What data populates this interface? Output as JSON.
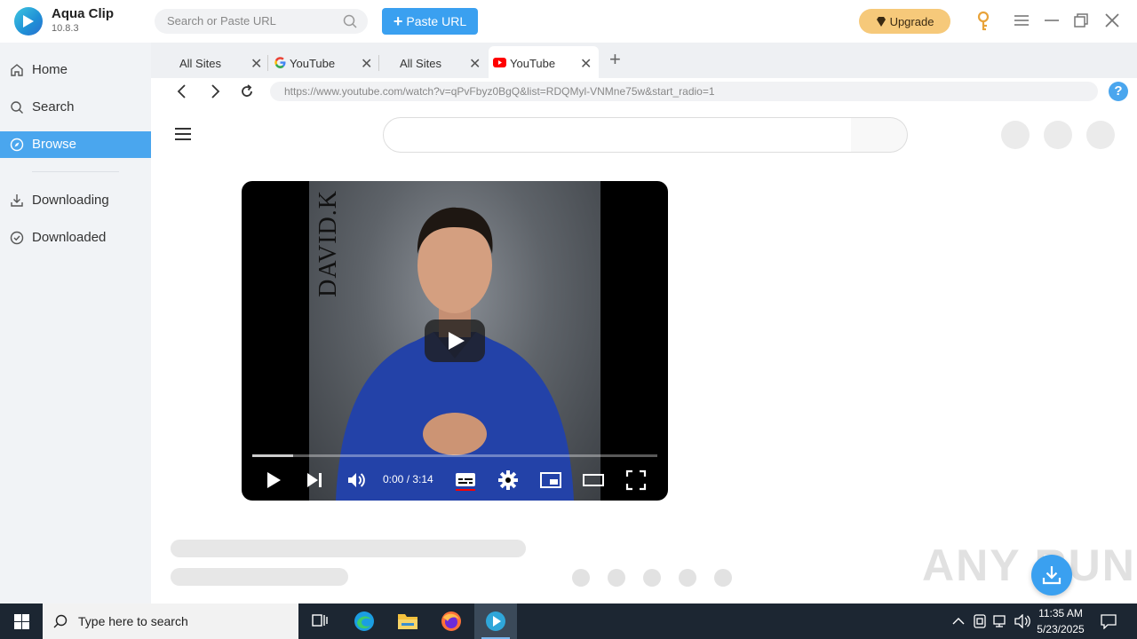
{
  "app": {
    "name": "Aqua Clip",
    "version": "10.8.3"
  },
  "header": {
    "search_placeholder": "Search or Paste URL",
    "paste_label": "Paste URL",
    "upgrade_label": "Upgrade"
  },
  "sidebar": {
    "items": [
      {
        "label": "Home",
        "icon": "home-icon"
      },
      {
        "label": "Search",
        "icon": "search-icon"
      },
      {
        "label": "Browse",
        "icon": "compass-icon",
        "active": true
      },
      {
        "label": "Downloading",
        "icon": "download-icon"
      },
      {
        "label": "Downloaded",
        "icon": "check-circle-icon"
      }
    ]
  },
  "tabs": [
    {
      "label": "All Sites"
    },
    {
      "label": "YouTube",
      "icon": "google-icon"
    },
    {
      "label": "All Sites"
    },
    {
      "label": "YouTube",
      "icon": "youtube-icon",
      "active": true
    }
  ],
  "address": {
    "url": "https://www.youtube.com/watch?v=qPvFbyz0BgQ&list=RDQMyl-VNMne75w&start_radio=1"
  },
  "player": {
    "overlay_text": "DAVID.K",
    "time": "0:00 / 3:14",
    "loaded_fraction": 0.1
  },
  "watermark": "ANY RUN",
  "taskbar": {
    "search_placeholder": "Type here to search",
    "time": "11:35 AM",
    "date": "5/23/2025"
  },
  "colors": {
    "accent": "#4aa6ee",
    "upgrade": "#f6c97a",
    "taskbar": "#1c2632"
  }
}
